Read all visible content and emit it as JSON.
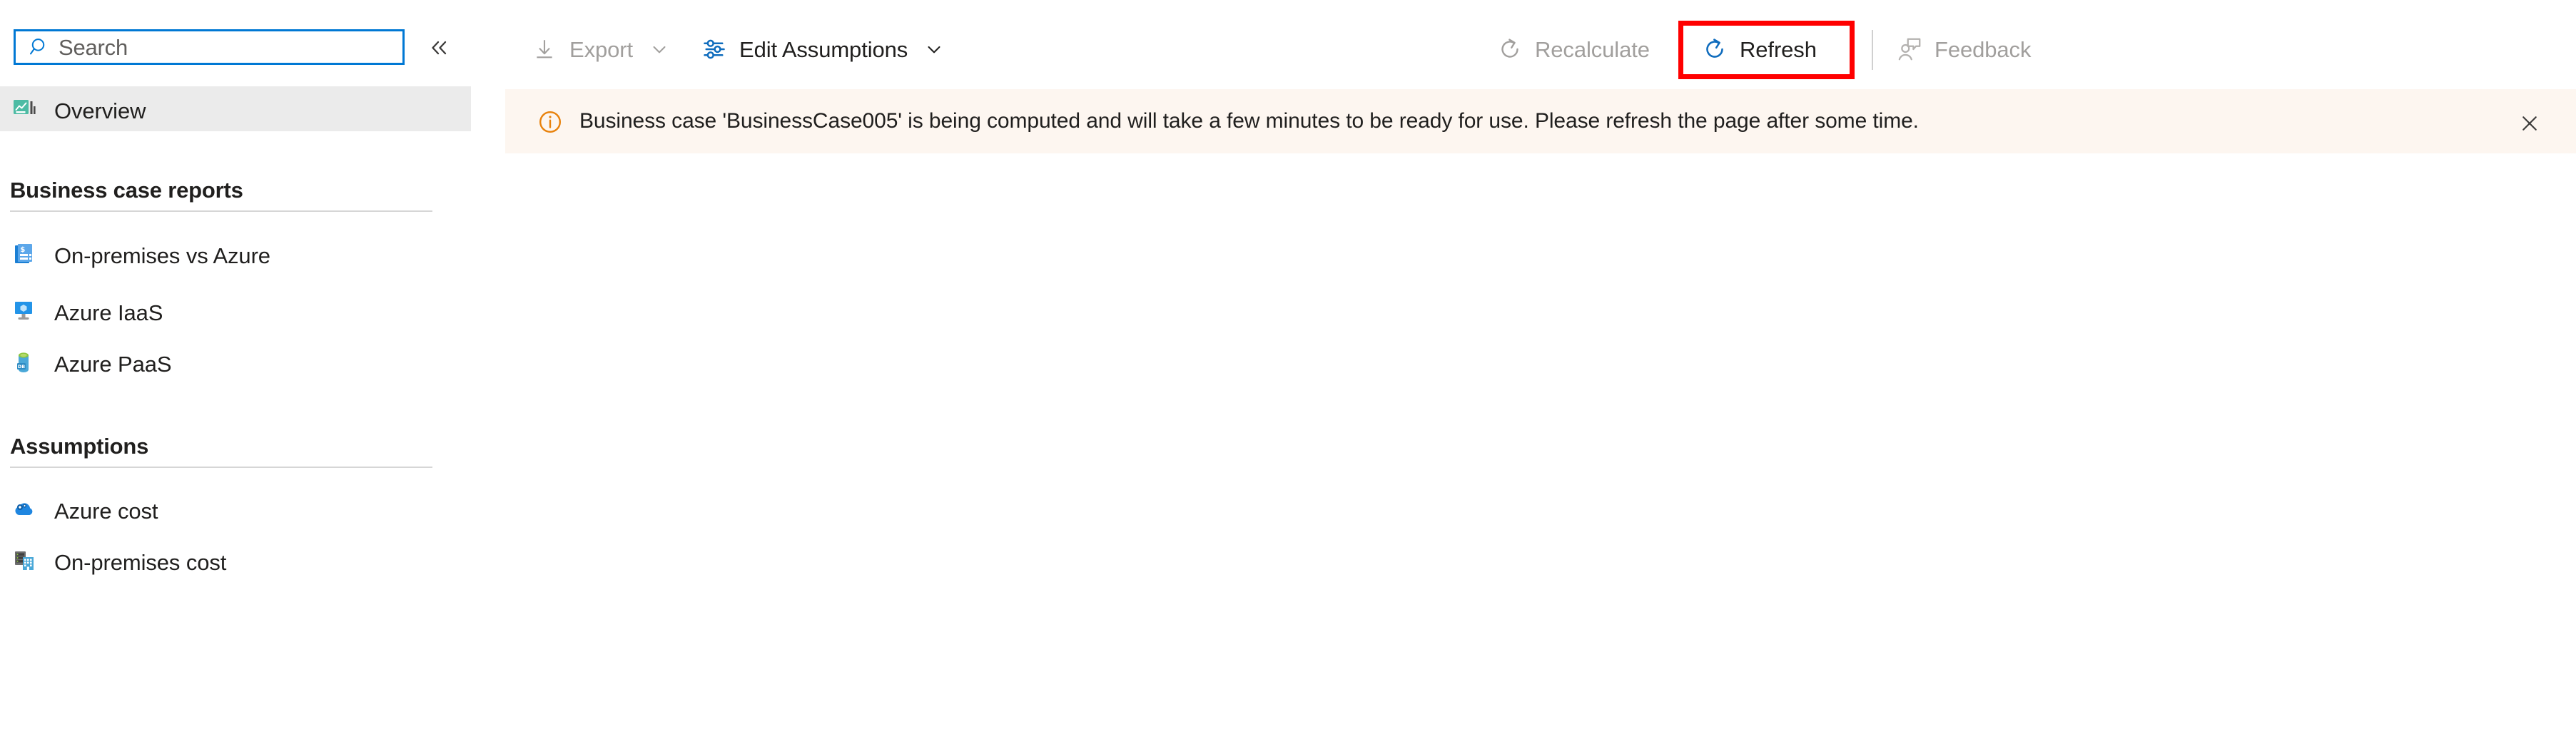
{
  "sidebar": {
    "search": {
      "placeholder": "Search",
      "value": "",
      "icon": "search-icon"
    },
    "collapse": {
      "label": "«",
      "icon": "chevron-double-left-icon"
    },
    "overview": {
      "label": "Overview",
      "icon": "overview-chart-icon",
      "selected": true
    },
    "sections": [
      {
        "title": "Business case reports",
        "items": [
          {
            "label": "On-premises vs Azure",
            "icon": "invoice-dollar-icon"
          },
          {
            "label": "Azure IaaS",
            "icon": "azure-vm-icon"
          },
          {
            "label": "Azure PaaS",
            "icon": "azure-database-icon"
          }
        ]
      },
      {
        "title": "Assumptions",
        "items": [
          {
            "label": "Azure cost",
            "icon": "cloud-gear-icon"
          },
          {
            "label": "On-premises cost",
            "icon": "server-building-icon"
          }
        ]
      }
    ]
  },
  "toolbar": {
    "buttons": [
      {
        "label": "Export",
        "icon": "download-arrow-icon",
        "enabled": false,
        "has_chevron": true
      },
      {
        "label": "Edit Assumptions",
        "icon": "sliders-icon",
        "enabled": true,
        "has_chevron": true
      },
      {
        "label": "Recalculate",
        "icon": "refresh-circle-icon",
        "enabled": false,
        "has_chevron": false
      },
      {
        "label": "Refresh",
        "icon": "refresh-circle-icon",
        "enabled": true,
        "has_chevron": false,
        "highlighted": true
      },
      {
        "label": "Feedback",
        "icon": "person-feedback-icon",
        "enabled": false,
        "has_chevron": false
      }
    ]
  },
  "notification": {
    "icon": "info-circle-icon",
    "message": "Business case 'BusinessCase005' is being computed and will take a few minutes to be ready for use. Please refresh the page after some time.",
    "close_icon": "close-icon",
    "background": "#fdf6f0",
    "accent": "#e8820c"
  },
  "colors": {
    "accent_blue": "#0078d4",
    "highlight_red": "#ff0000",
    "selected_bg": "#ebebeb",
    "disabled_text": "#a19f9d",
    "text": "#201f1e"
  }
}
